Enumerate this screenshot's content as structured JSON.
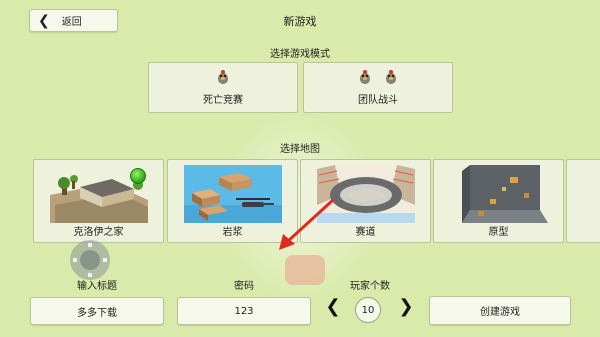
{
  "header": {
    "back_label": "返回",
    "title": "新游戏"
  },
  "mode_section": {
    "heading": "选择游戏模式",
    "modes": [
      {
        "label": "死亡竞赛"
      },
      {
        "label": "团队战斗"
      }
    ]
  },
  "map_section": {
    "heading": "选择地图",
    "maps": [
      {
        "label": "克洛伊之家"
      },
      {
        "label": "岩浆"
      },
      {
        "label": "赛道"
      },
      {
        "label": "原型"
      }
    ]
  },
  "form": {
    "title_label": "输入标题",
    "title_value": "多多下载",
    "password_label": "密码",
    "password_value": "123",
    "players_label": "玩家个数",
    "players_value": "10",
    "create_label": "创建游戏"
  },
  "colors": {
    "background": "#d9eaaa",
    "button_bg": "#f6f8ec",
    "arrow": "#e02a1e"
  },
  "icons": [
    "chevron-left-icon",
    "chicken-icon",
    "chevron-right-icon",
    "joystick-icon",
    "arrow-icon"
  ]
}
